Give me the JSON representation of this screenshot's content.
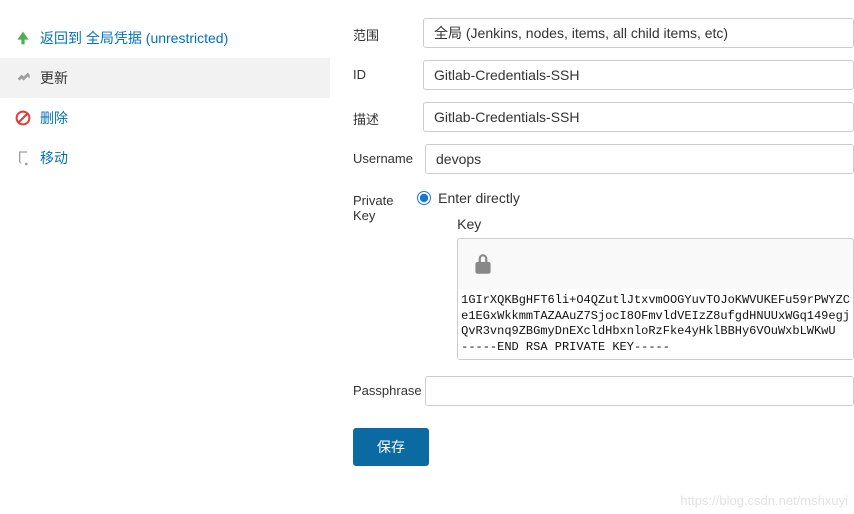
{
  "sidebar": {
    "items": [
      {
        "label": "返回到 全局凭据 (unrestricted)"
      },
      {
        "label": "更新"
      },
      {
        "label": "删除"
      },
      {
        "label": "移动"
      }
    ]
  },
  "form": {
    "scope": {
      "label": "范围",
      "value": "全局 (Jenkins, nodes, items, all child items, etc)"
    },
    "id": {
      "label": "ID",
      "value": "Gitlab-Credentials-SSH"
    },
    "description": {
      "label": "描述",
      "value": "Gitlab-Credentials-SSH"
    },
    "username": {
      "label": "Username",
      "value": "devops"
    },
    "privateKey": {
      "label": "Private Key",
      "radioLabel": "Enter directly",
      "subLabel": "Key",
      "keyText": "1GIrXQKBgHFT6li+O4QZutlJtxvmOOGYuvTOJoKWVUKEFu59rPWYZC\ne1EGxWkkmmTAZAAuZ7SjocI8OFmvldVEIzZ8ufgdHNUUxWGq149egj\nQvR3vnq9ZBGmyDnEXcldHbxnloRzFke4yHklBBHy6VOuWxbLWKwU\n-----END RSA PRIVATE KEY-----"
    },
    "passphrase": {
      "label": "Passphrase",
      "value": ""
    },
    "saveLabel": "保存"
  },
  "watermark": "https://blog.csdn.net/mshxuyi"
}
